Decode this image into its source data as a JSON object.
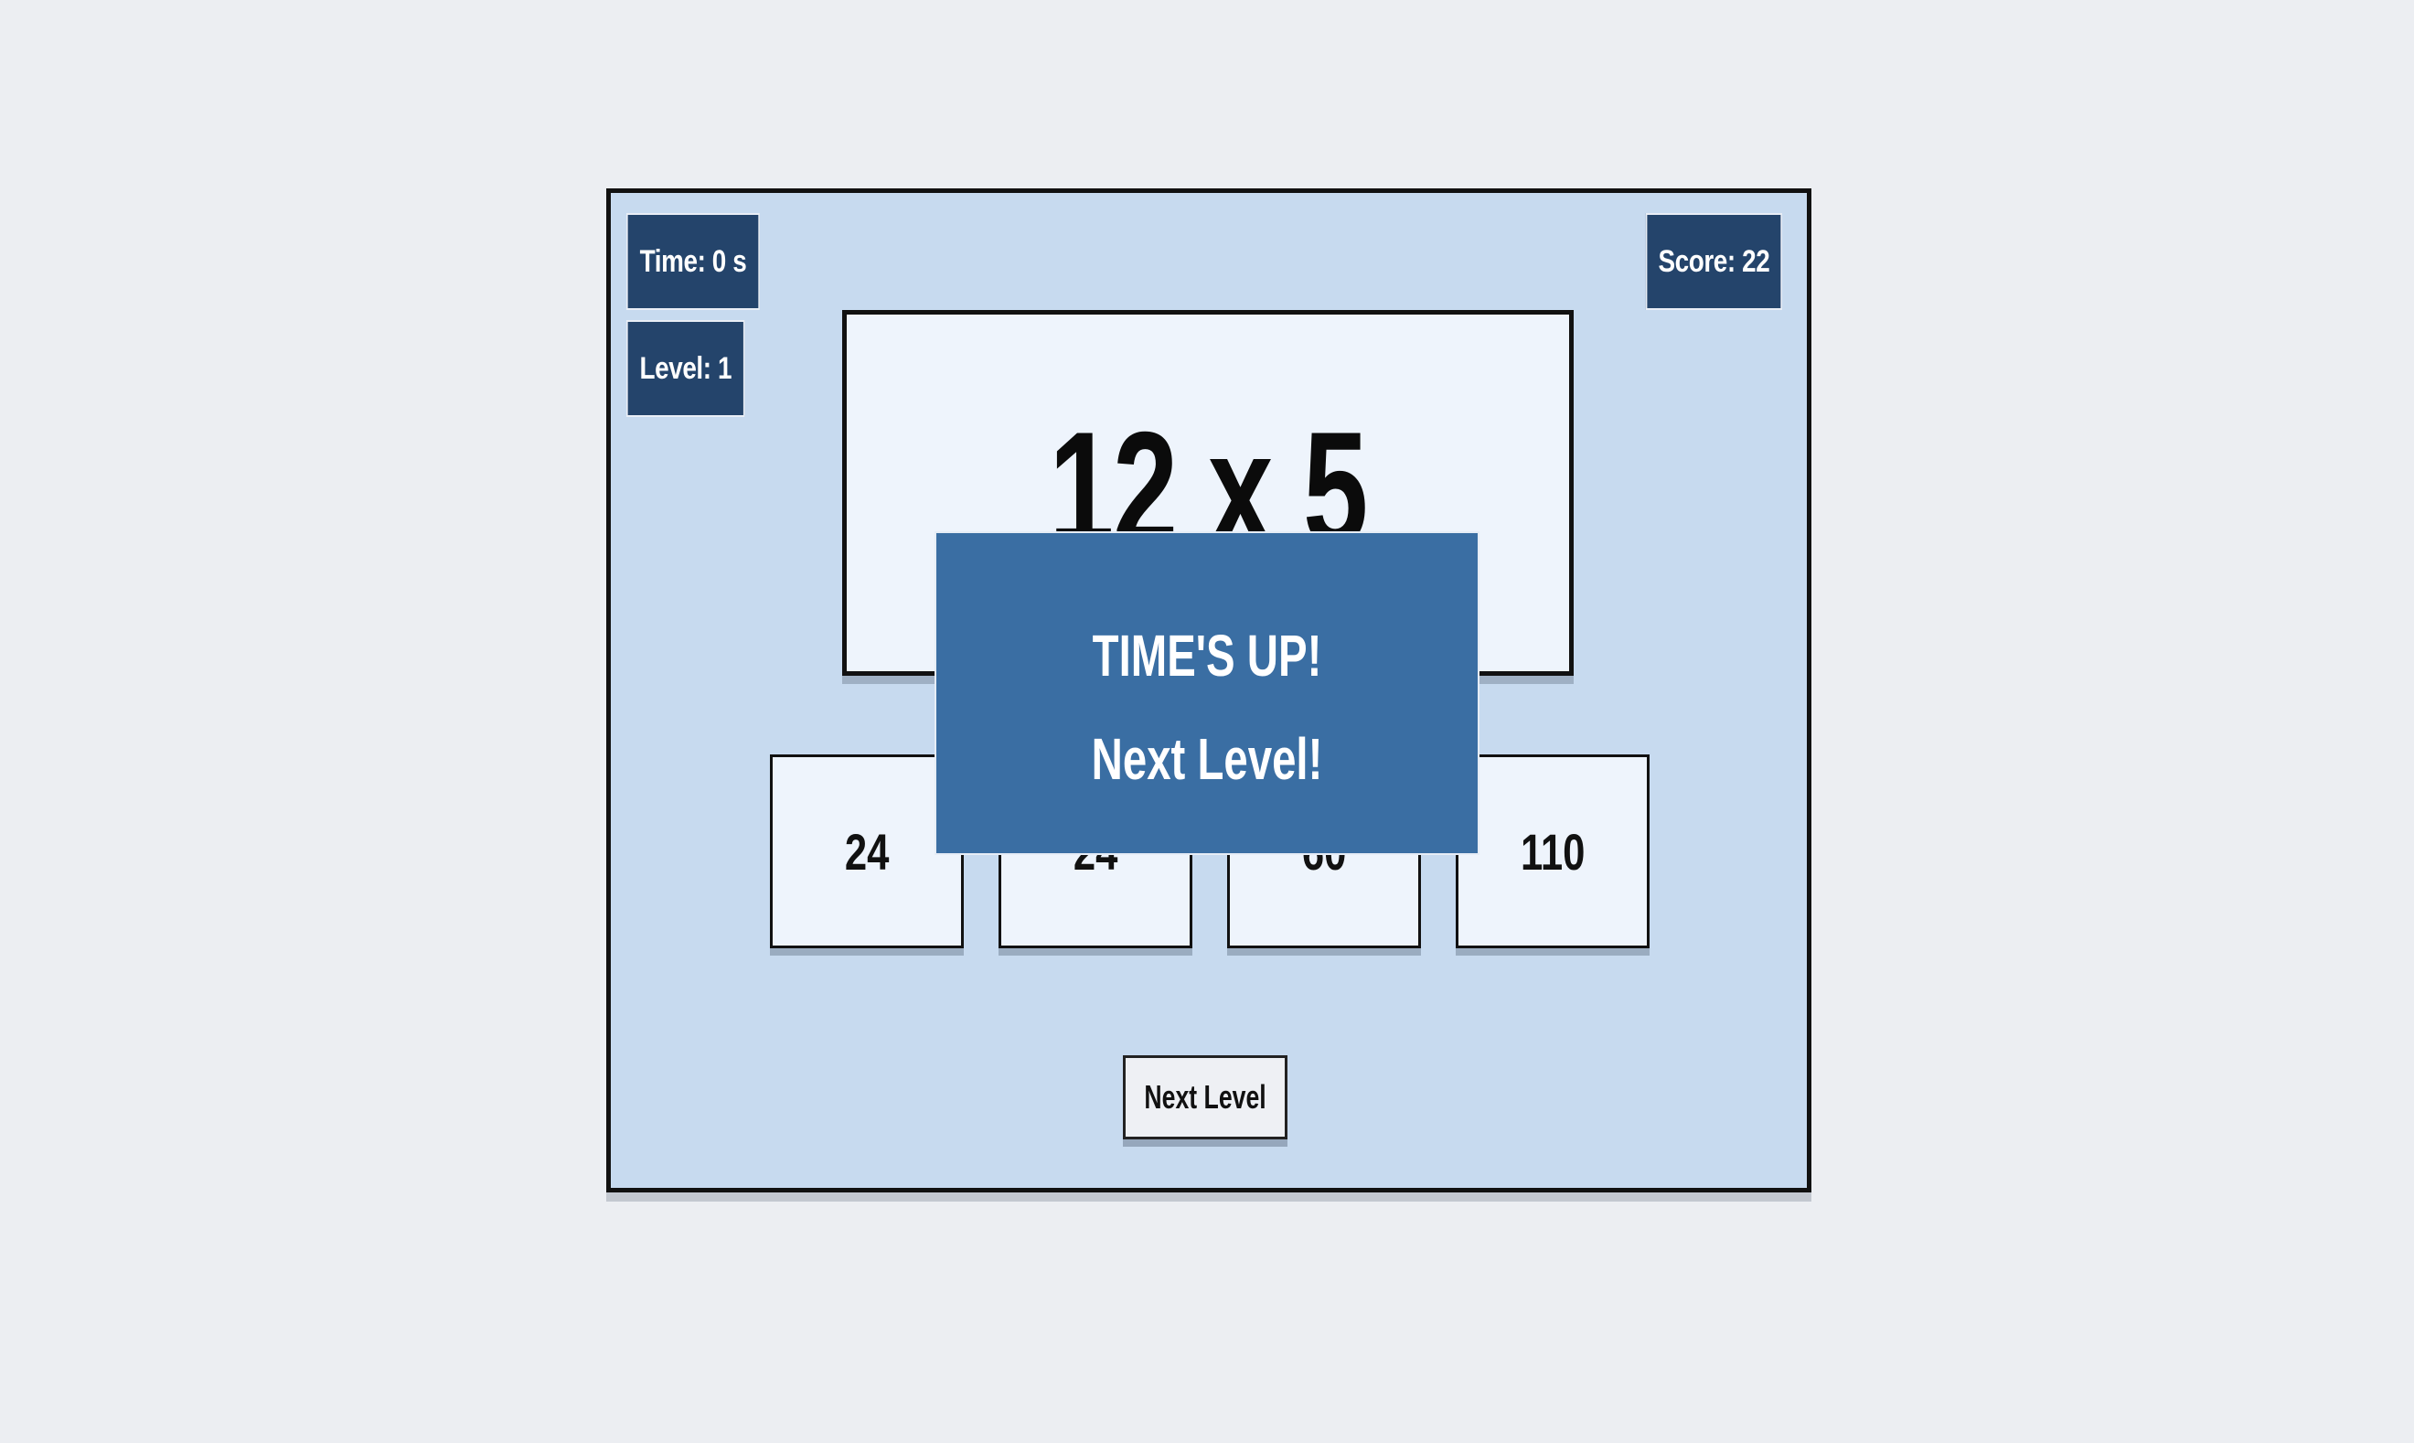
{
  "hud": {
    "time": "Time: 0 s",
    "level": "Level: 1",
    "score": "Score: 22"
  },
  "question": {
    "text": "12 x 5"
  },
  "answers": [
    "24",
    "24",
    "60",
    "110"
  ],
  "overlay": {
    "line1": "TIME'S UP!",
    "line2": "Next Level!"
  },
  "next_button": {
    "label": "Next Level"
  },
  "colors": {
    "hud_bg": "#24446b",
    "board_bg": "#c7daef",
    "card_bg": "#eef4fc",
    "overlay_bg": "#3a6ea3"
  }
}
